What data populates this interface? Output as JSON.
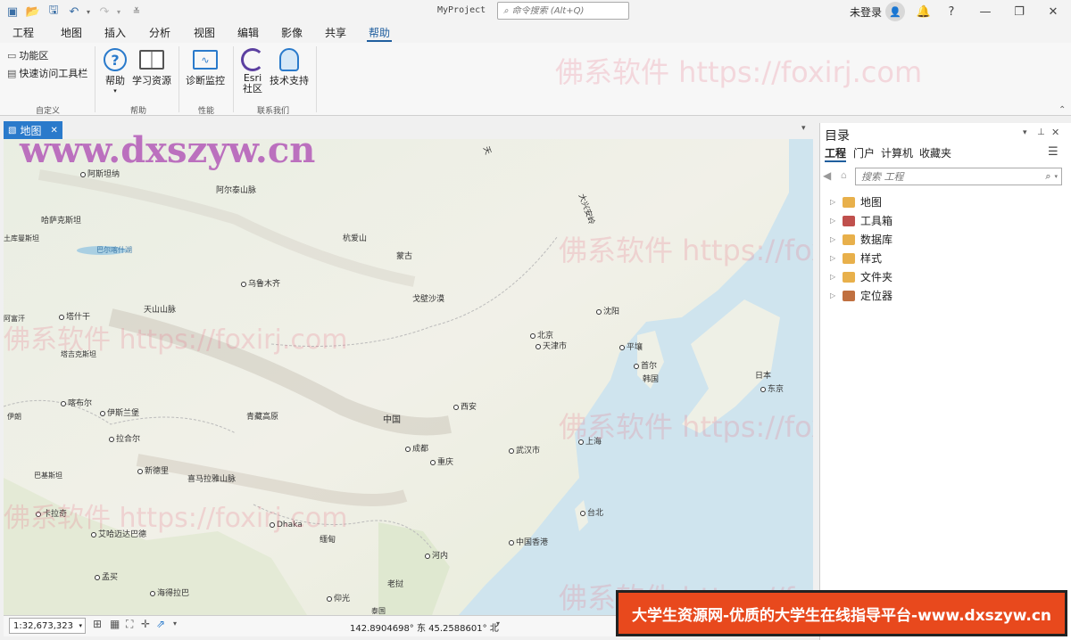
{
  "titlebar": {
    "project_title": "MyProject",
    "command_search_placeholder": "命令搜索 (Alt+Q)",
    "signin": "未登录",
    "help_glyph": "?"
  },
  "menu_tabs": [
    "工程",
    "地图",
    "插入",
    "分析",
    "视图",
    "编辑",
    "影像",
    "共享",
    "帮助"
  ],
  "active_tab": "帮助",
  "ribbon": {
    "customize": {
      "items": [
        "功能区",
        "快速访问工具栏"
      ],
      "label": "自定义"
    },
    "help": {
      "buttons": [
        "帮助",
        "学习资源"
      ],
      "label": "帮助"
    },
    "performance": {
      "buttons": [
        "诊断监控"
      ],
      "label": "性能"
    },
    "contact": {
      "buttons": [
        "Esri 社区",
        "技术支持"
      ],
      "label": "联系我们"
    }
  },
  "map_view": {
    "tab_label": "地图",
    "labels": [
      {
        "t": "阿斯坦纳",
        "dot": true
      },
      {
        "t": "阿尔泰山脉"
      },
      {
        "t": "哈萨克斯坦"
      },
      {
        "t": "巴尔喀什湖",
        "water": true
      },
      {
        "t": "杭爱山"
      },
      {
        "t": "蒙古"
      },
      {
        "t": "乌鲁木齐",
        "dot": true
      },
      {
        "t": "戈壁沙漠"
      },
      {
        "t": "天山山脉"
      },
      {
        "t": "塔什干",
        "dot": true
      },
      {
        "t": "塔吉克斯坦"
      },
      {
        "t": "喀布尔",
        "dot": true
      },
      {
        "t": "伊斯兰堡",
        "dot": true
      },
      {
        "t": "拉合尔",
        "dot": true
      },
      {
        "t": "青藏高原"
      },
      {
        "t": "中国"
      },
      {
        "t": "西安",
        "dot": true
      },
      {
        "t": "成都",
        "dot": true
      },
      {
        "t": "重庆",
        "dot": true
      },
      {
        "t": "武汉市",
        "dot": true
      },
      {
        "t": "上海",
        "dot": true
      },
      {
        "t": "北京",
        "dot": true
      },
      {
        "t": "天津市",
        "dot": true
      },
      {
        "t": "沈阳",
        "dot": true
      },
      {
        "t": "平壤",
        "dot": true
      },
      {
        "t": "首尔",
        "dot": true
      },
      {
        "t": "韩国"
      },
      {
        "t": "日本"
      },
      {
        "t": "东京",
        "dot": true
      },
      {
        "t": "台北",
        "dot": true
      },
      {
        "t": "中国香港",
        "dot": true
      },
      {
        "t": "河内",
        "dot": true
      },
      {
        "t": "老挝"
      },
      {
        "t": "缅甸"
      },
      {
        "t": "Dhaka",
        "dot": true
      },
      {
        "t": "喜马拉雅山脉"
      },
      {
        "t": "新德里",
        "dot": true
      },
      {
        "t": "巴基斯坦"
      },
      {
        "t": "卡拉奇",
        "dot": true
      },
      {
        "t": "艾哈迈达巴德",
        "dot": true
      },
      {
        "t": "孟买",
        "dot": true
      },
      {
        "t": "海得拉巴",
        "dot": true
      },
      {
        "t": "仰光",
        "dot": true
      },
      {
        "t": "泰国"
      },
      {
        "t": "大兴安岭"
      },
      {
        "t": "阿富汗"
      },
      {
        "t": "伊朗"
      },
      {
        "t": "土库曼斯坦"
      },
      {
        "t": "天"
      }
    ]
  },
  "statusbar": {
    "scale": "1:32,673,323",
    "coords": "142.8904698° 东 45.2588601° 北"
  },
  "catalog": {
    "title": "目录",
    "tabs": [
      "工程",
      "门户",
      "计算机",
      "收藏夹"
    ],
    "active_tab": "工程",
    "search_placeholder": "搜索 工程",
    "items": [
      {
        "label": "地图",
        "icon": "map-folder-icon",
        "color": "#e8b04b"
      },
      {
        "label": "工具箱",
        "icon": "toolbox-icon",
        "color": "#c0504d"
      },
      {
        "label": "数据库",
        "icon": "database-icon",
        "color": "#e8b04b"
      },
      {
        "label": "样式",
        "icon": "style-icon",
        "color": "#e8b04b"
      },
      {
        "label": "文件夹",
        "icon": "folder-icon",
        "color": "#e8b04b"
      },
      {
        "label": "定位器",
        "icon": "locator-icon",
        "color": "#c07040"
      }
    ]
  },
  "watermarks": {
    "foxirj": "佛系软件 https://foxirj.com",
    "dxszyw": "www.dxszyw.cn"
  },
  "banner": "大学生资源网-优质的大学生在线指导平台-www.dxszyw.cn"
}
